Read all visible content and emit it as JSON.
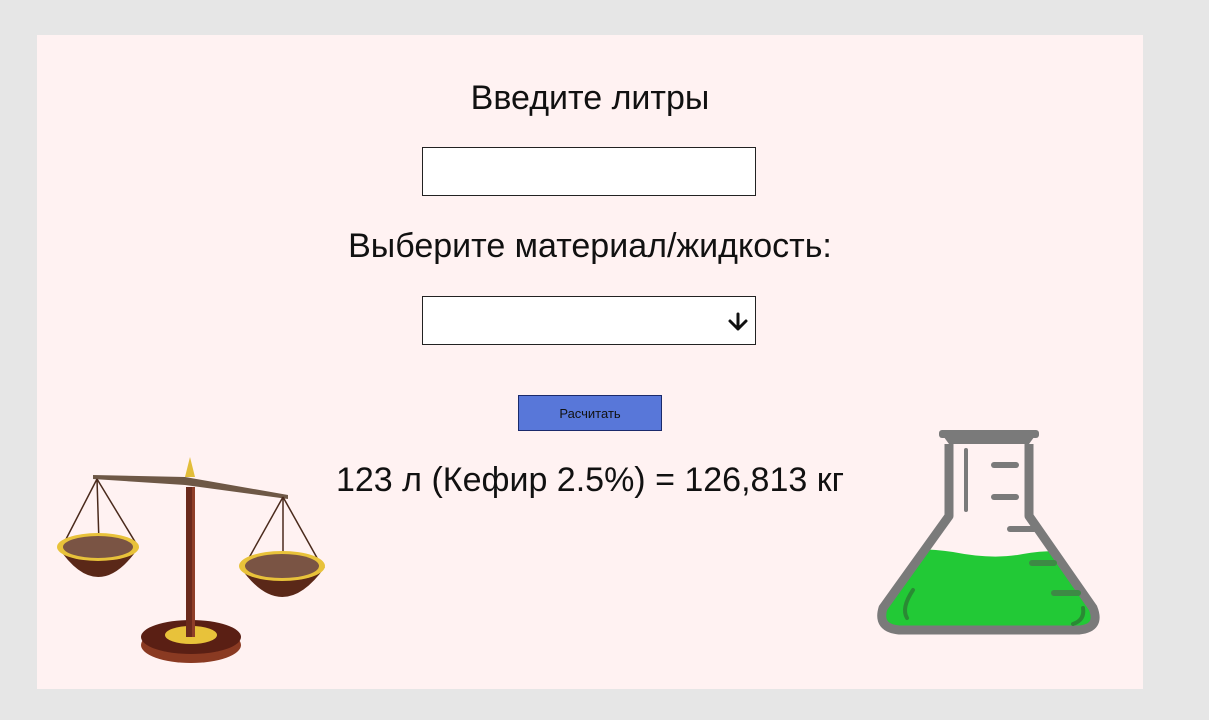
{
  "form": {
    "liters_label": "Введите литры",
    "liters_value": "",
    "material_label": "Выберите материал/жидкость:",
    "material_selected": "",
    "calculate_label": "Расчитать"
  },
  "result": {
    "text": "123 л (Кефир 2.5%) = 126,813 кг"
  },
  "icons": {
    "select_arrow": "arrow-down-icon",
    "left_illustration": "scales-icon",
    "right_illustration": "flask-icon"
  },
  "colors": {
    "page_background": "#e6e6e6",
    "card_background": "#fff2f2",
    "button_background": "#5877d9",
    "flask_liquid": "#22c936"
  }
}
